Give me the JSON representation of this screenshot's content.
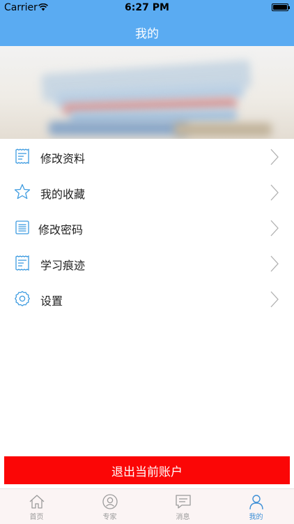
{
  "status_bar": {
    "carrier": "Carrier",
    "time": "6:27 PM"
  },
  "nav": {
    "title": "我的"
  },
  "menu": {
    "items": [
      {
        "label": "修改资料",
        "icon": "receipt-icon"
      },
      {
        "label": "我的收藏",
        "icon": "star-icon"
      },
      {
        "label": "修改密码",
        "icon": "list-icon"
      },
      {
        "label": "学习痕迹",
        "icon": "receipt-icon"
      },
      {
        "label": "设置",
        "icon": "gear-icon"
      }
    ]
  },
  "logout": {
    "label": "退出当前账户"
  },
  "tabbar": {
    "tabs": [
      {
        "label": "首页",
        "icon": "home-icon"
      },
      {
        "label": "专家",
        "icon": "expert-icon"
      },
      {
        "label": "消息",
        "icon": "message-icon"
      },
      {
        "label": "我的",
        "icon": "user-icon",
        "active": true
      }
    ]
  },
  "colors": {
    "nav_bg": "#5aabf2",
    "accent": "#3d8fd6",
    "logout_bg": "#fb0606",
    "tab_inactive": "#9a9a9a",
    "tabbar_bg": "#fbf4f4"
  }
}
